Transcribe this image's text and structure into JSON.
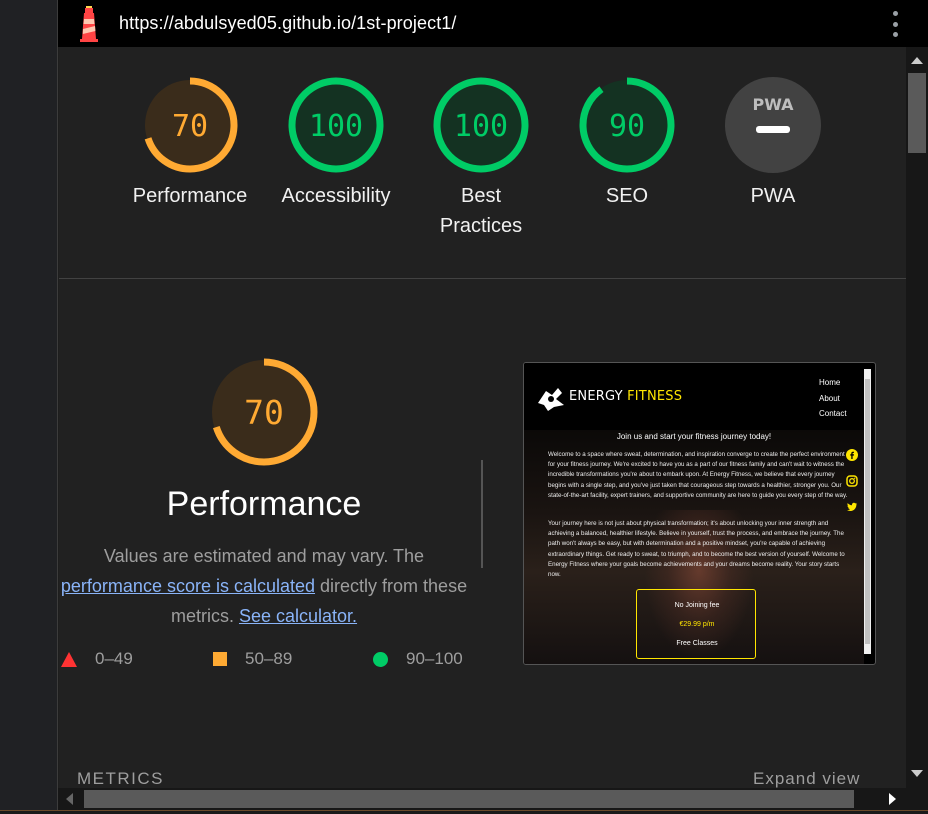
{
  "browser": {
    "url": "https://abdulsyed05.github.io/1st-project1/",
    "logo_icon": "lighthouse-icon",
    "menu_icon": "kebab-menu-icon"
  },
  "colors": {
    "fail": "#ff3333",
    "average": "#ffaa33",
    "pass": "#00cc66",
    "na": "#9e9e9e",
    "background": "#212121"
  },
  "scores": [
    {
      "label": "Performance",
      "value": "70",
      "score": 70,
      "status": "average"
    },
    {
      "label": "Accessibility",
      "value": "100",
      "score": 100,
      "status": "pass"
    },
    {
      "label": "Best\nPractices",
      "label_line1": "Best",
      "label_line2": "Practices",
      "value": "100",
      "score": 100,
      "status": "pass"
    },
    {
      "label": "SEO",
      "value": "90",
      "score": 90,
      "status": "pass"
    },
    {
      "label": "PWA",
      "value": "",
      "status": "na",
      "badge_text": "PWA"
    }
  ],
  "performance": {
    "score": "70",
    "score_value": 70,
    "title": "Performance",
    "desc_part1": "Values are estimated and may vary. The",
    "desc_link1": "performance score is calculated",
    "desc_part2": " directly from these metrics.",
    "desc_link2": "See calculator."
  },
  "legend": [
    {
      "range": "0–49",
      "shape": "triangle"
    },
    {
      "range": "50–89",
      "shape": "square"
    },
    {
      "range": "90–100",
      "shape": "circle"
    }
  ],
  "thumbnail": {
    "brand_white": "ENERGY ",
    "brand_yellow": "FITNESS",
    "nav": [
      "Home",
      "About",
      "Contact"
    ],
    "tagline": "Join us and start your fitness journey today!",
    "para1": "Welcome to a space where sweat, determination, and inspiration converge to create the perfect environment for your fitness journey. We're excited to have you as a part of our fitness family and can't wait to witness the incredible transformations you're about to embark upon. At Energy Fitness, we believe that every journey begins with a single step, and you've just taken that courageous step towards a healthier, stronger you. Our state-of-the-art facility, expert trainers, and supportive community are here to guide you every step of the way.",
    "para2": "Your journey here is not just about physical transformation; it's about unlocking your inner strength and achieving a balanced, healthier lifestyle. Believe in yourself, trust the process, and embrace the journey. The path won't always be easy, but with determination and a positive mindset, you're capable of achieving extraordinary things. Get ready to sweat, to triumph, and to become the best version of yourself. Welcome to Energy Fitness where your goals become achievements and your dreams become reality. Your story starts now.",
    "social_icons": [
      "facebook-icon",
      "instagram-icon",
      "twitter-icon"
    ],
    "price_line1": "No Joining fee",
    "price_line2": "€29.99 p/m",
    "price_line3": "Free Classes"
  },
  "sections": {
    "metrics": "METRICS",
    "expand": "Expand view"
  }
}
